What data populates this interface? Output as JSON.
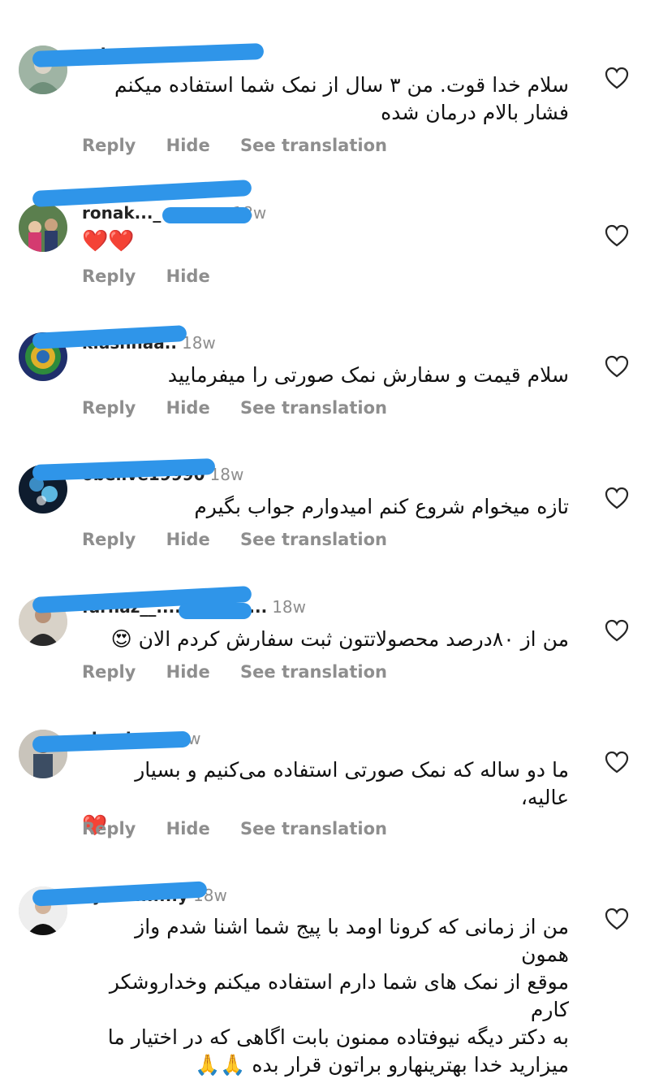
{
  "labels": {
    "reply": "Reply",
    "hide": "Hide",
    "see_translation": "See translation"
  },
  "comments": [
    {
      "username": "...h_roizbakth",
      "age": "18w",
      "lines": [
        "سلام خدا قوت. من ۳ سال از نمک شما استفاده میکنم",
        "فشار بالام درمان شده"
      ]
    },
    {
      "username": "ronak..._ ........n",
      "age": "18w",
      "emoji": "❤️❤️"
    },
    {
      "username": "k.ashnaa..",
      "age": "18w",
      "lines": [
        "سلام قیمت و سفارش نمک صورتی را میفرمایید"
      ]
    },
    {
      "username": "obelive19990",
      "age": "18w",
      "lines": [
        "تازه میخوام شروع کنم امیدوارم جواب بگیرم"
      ]
    },
    {
      "username": "farnaz__..................",
      "age": "18w",
      "lines": [
        "من از ۸۰درصد محصولاتتون ثبت سفارش کردم الان 😍"
      ]
    },
    {
      "username": "chaui.....",
      "age": "18w",
      "lines": [
        "ما دو ساله که نمک صورتی استفاده می‌کنیم و بسیار عالیه،",
        "❤️"
      ]
    },
    {
      "username": "f.jafar.......y",
      "age": "18w",
      "lines": [
        "من از زمانی که کرونا اومد با پیج شما اشنا شدم واز همون",
        "موقع از نمک های شما دارم استفاده میکنم وخداروشکر کارم",
        "به دکتر دیگه نیوفتاده ممنون بابت اگاهی که در اختیار ما",
        "میزارید خدا بهترینهارو براتون قرار بده 🙏🙏"
      ]
    }
  ]
}
